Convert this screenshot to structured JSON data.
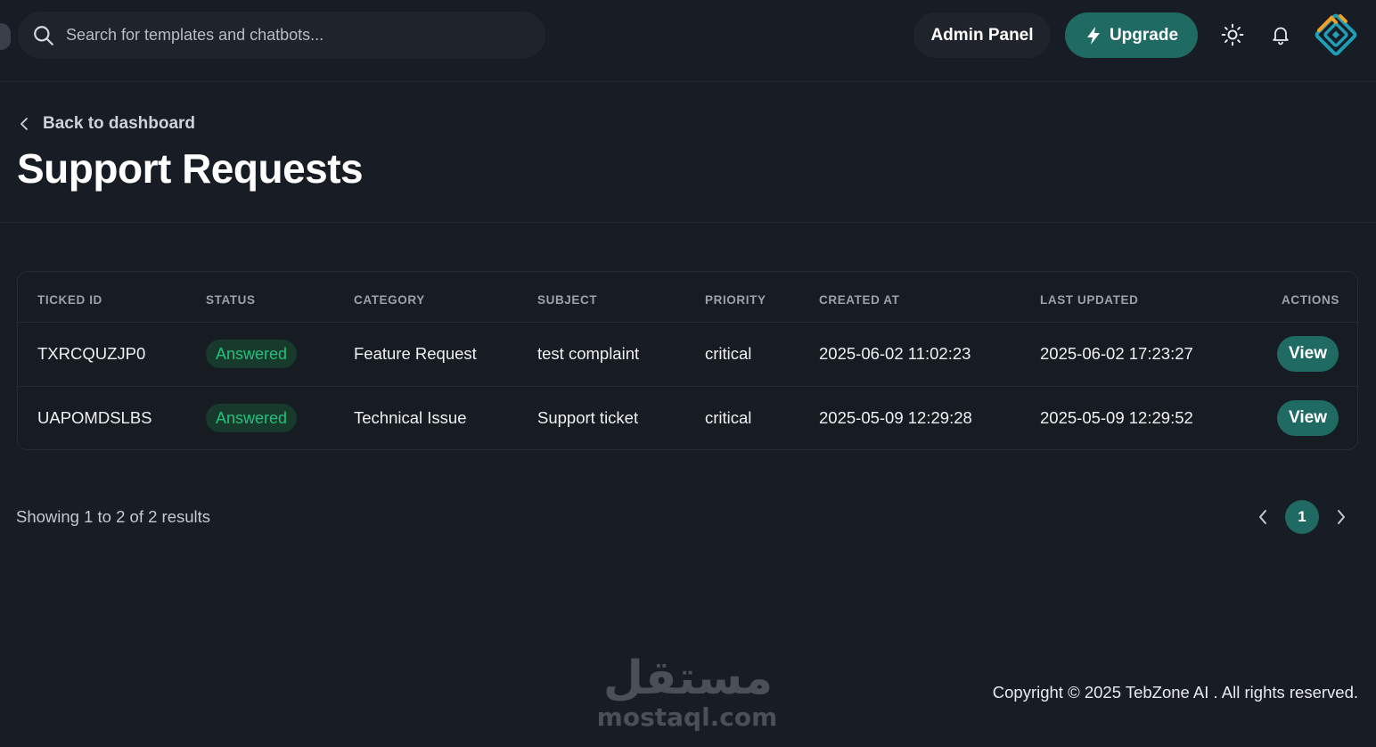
{
  "header": {
    "search_placeholder": "Search for templates and chatbots...",
    "admin_label": "Admin Panel",
    "upgrade_label": "Upgrade",
    "icons": [
      "search-icon",
      "lightning-icon",
      "sun-icon",
      "bell-icon",
      "logo-avatar"
    ]
  },
  "page": {
    "back_label": "Back to dashboard",
    "title": "Support Requests"
  },
  "table": {
    "columns": [
      "TICKED ID",
      "STATUS",
      "CATEGORY",
      "SUBJECT",
      "PRIORITY",
      "CREATED AT",
      "LAST UPDATED",
      "ACTIONS"
    ],
    "rows": [
      {
        "id": "TXRCQUZJP0",
        "status": "Answered",
        "category": "Feature Request",
        "subject": "test complaint",
        "priority": "critical",
        "created_at": "2025-06-02 11:02:23",
        "last_updated": "2025-06-02 17:23:27",
        "action": "View"
      },
      {
        "id": "UAPOMDSLBS",
        "status": "Answered",
        "category": "Technical Issue",
        "subject": "Support ticket",
        "priority": "critical",
        "created_at": "2025-05-09 12:29:28",
        "last_updated": "2025-05-09 12:29:52",
        "action": "View"
      }
    ]
  },
  "pagination": {
    "summary": "Showing 1 to 2 of 2 results",
    "current_page": "1"
  },
  "footer": {
    "watermark_arabic": "مستقل",
    "watermark_latin": "mostaql.com",
    "copyright": "Copyright © 2025 TebZone AI . All rights reserved."
  },
  "colors": {
    "background": "#181c24",
    "accent": "#1f6a63",
    "status_text": "#22c17a",
    "status_bg": "#173a2c"
  }
}
